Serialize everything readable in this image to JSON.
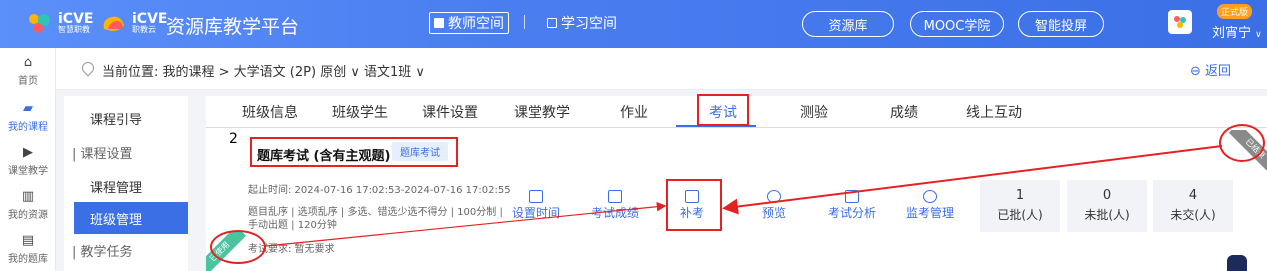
{
  "header": {
    "logo1_text": "iCVE",
    "logo1_sub": "智慧职教",
    "logo2_text": "iCVE",
    "logo2_sub": "职教云",
    "platform_title": "资源库教学平台",
    "space_teacher": "教师空间",
    "space_student": "学习空间",
    "pills": [
      "资源库",
      "MOOC学院",
      "智能投屏"
    ],
    "badge": "正式版",
    "username": "刘宵宁",
    "brand_color": "#3b6fe6"
  },
  "leftnav": {
    "items": [
      {
        "icon": "home-icon",
        "glyph": "⌂",
        "label": "首页"
      },
      {
        "icon": "book-icon",
        "glyph": "▰",
        "label": "我的课程"
      },
      {
        "icon": "play-icon",
        "glyph": "▶",
        "label": "课堂教学"
      },
      {
        "icon": "library-icon",
        "glyph": "▥",
        "label": "我的资源"
      },
      {
        "icon": "question-bank-icon",
        "glyph": "▤",
        "label": "我的题库"
      }
    ]
  },
  "breadcrumb": {
    "text": "当前位置: 我的课程 > 大学语文 (2P) 原创 ∨ 语文1班 ∨",
    "back": "返回"
  },
  "subside": {
    "items": [
      "课程引导",
      "| 课程设置",
      "课程管理",
      "班级管理",
      "| 教学任务"
    ]
  },
  "tabs": [
    "班级信息",
    "班级学生",
    "课件设置",
    "课堂教学",
    "作业",
    "考试",
    "测验",
    "成绩",
    "线上互动"
  ],
  "exam": {
    "index": "2",
    "title": "题库考试 (含有主观题)",
    "tag": "题库考试",
    "time": "起止时间: 2024-07-16 17:02:53-2024-07-16 17:02:55",
    "rules_line1": "题目乱序 | 选项乱序 | 多选、错选少选不得分 | 100分制 |",
    "rules_line2": "手动出题 | 120分钟",
    "requirement": "考试要求: 暂无要求",
    "ended_ribbon": "已结束",
    "used_ribbon": "已使用"
  },
  "actions": [
    {
      "icon": "clock-icon",
      "label": "设置时间"
    },
    {
      "icon": "score-icon",
      "label": "考试成绩"
    },
    {
      "icon": "makeup-exam-icon",
      "label": "补考"
    },
    {
      "icon": "eye-icon",
      "label": "预览"
    },
    {
      "icon": "analysis-icon",
      "label": "考试分析"
    },
    {
      "icon": "monitor-icon",
      "label": "监考管理"
    }
  ],
  "stats": [
    {
      "num": "1",
      "label": "已批(人)"
    },
    {
      "num": "0",
      "label": "未批(人)"
    },
    {
      "num": "4",
      "label": "未交(人)"
    }
  ],
  "annotation_color": "#e52222"
}
